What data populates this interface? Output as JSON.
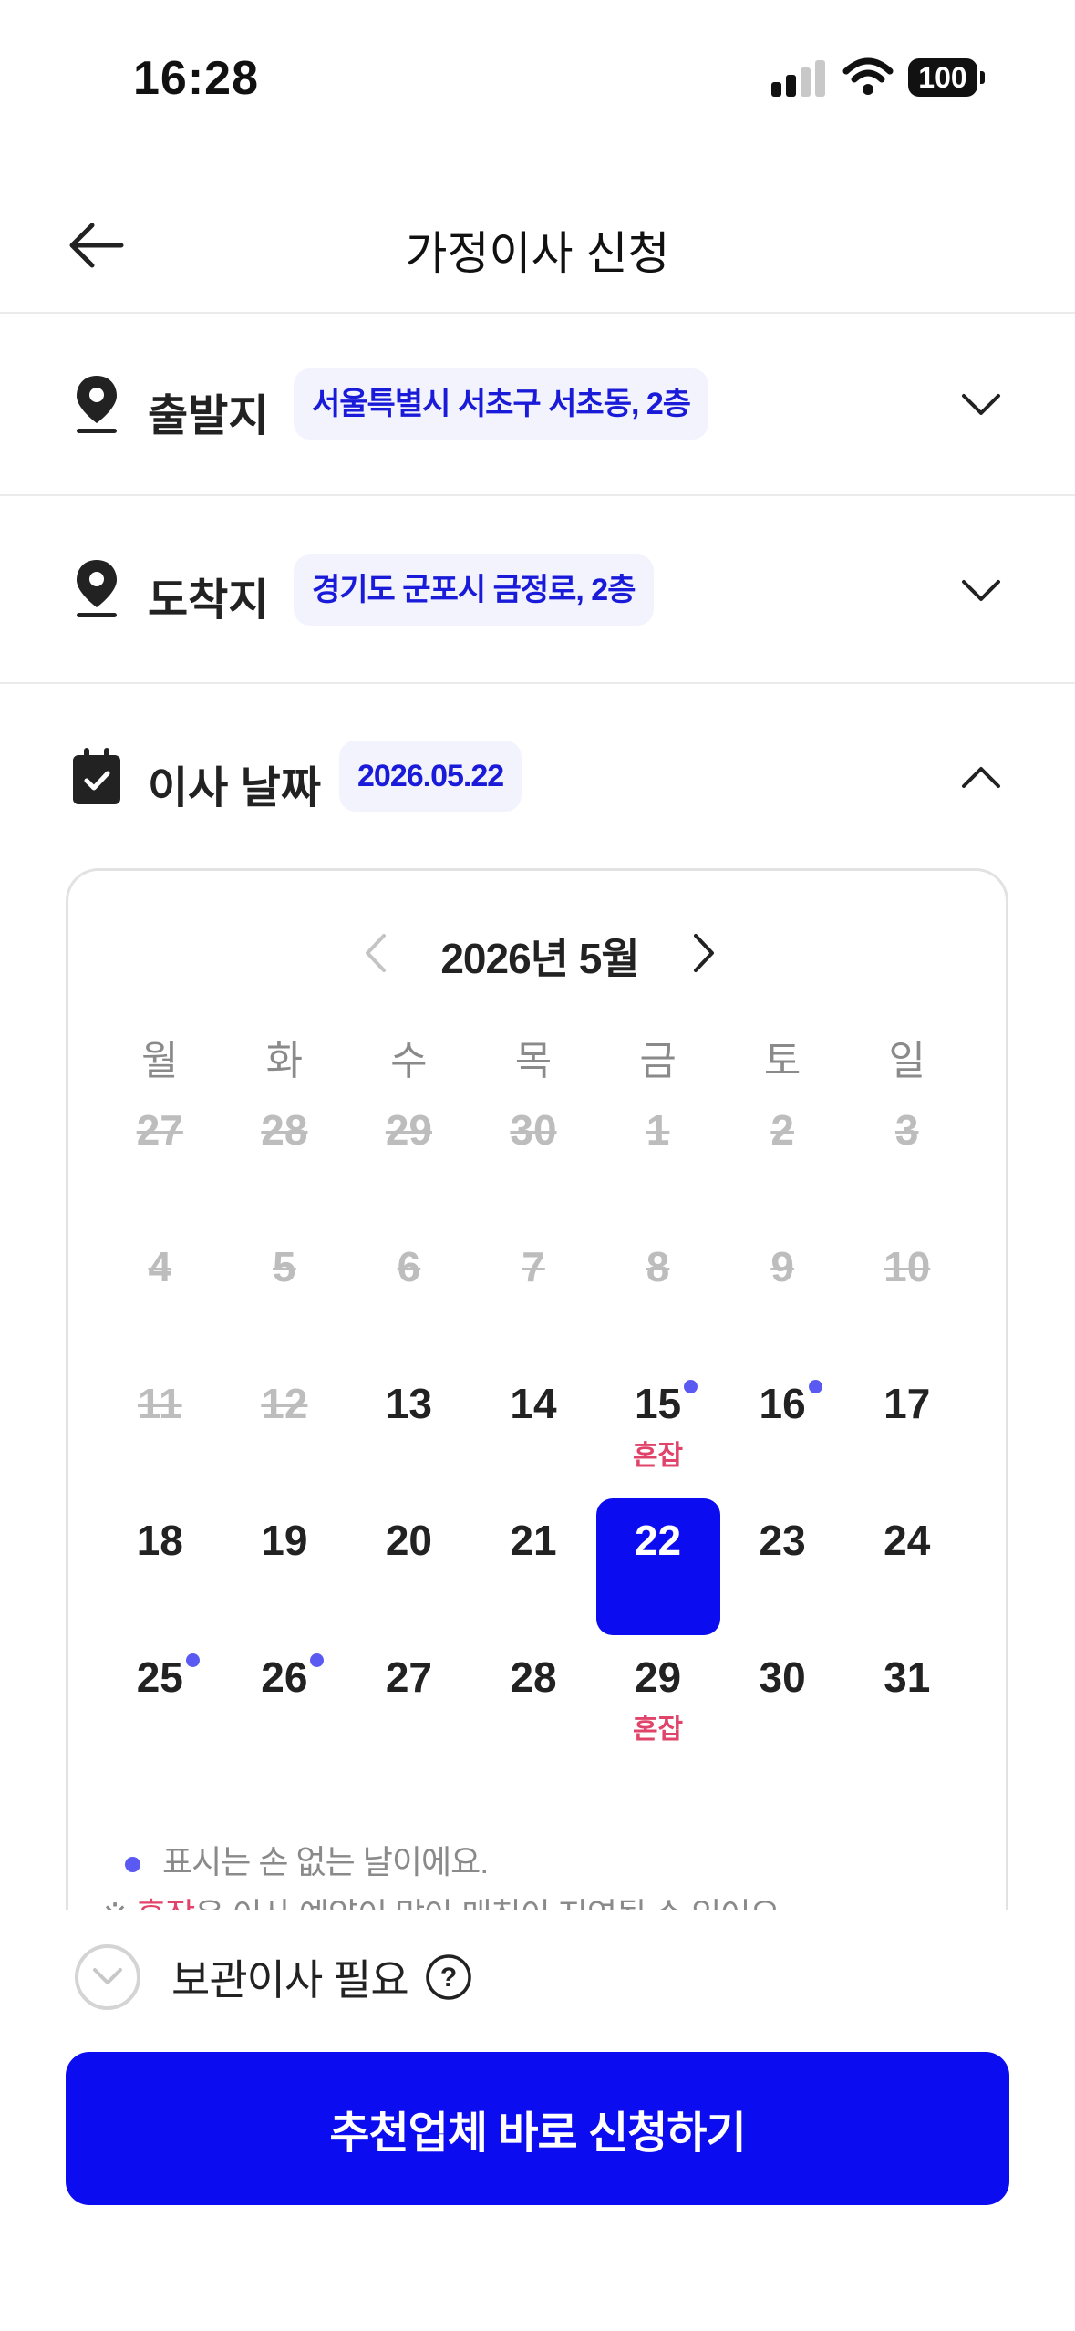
{
  "status_bar": {
    "time": "16:28",
    "battery": "100"
  },
  "header": {
    "title": "가정이사 신청"
  },
  "departure": {
    "label": "출발지",
    "value": "서울특별시 서초구 서초동, 2층"
  },
  "arrival": {
    "label": "도착지",
    "value": "경기도 군포시 금정로, 2층"
  },
  "move_date": {
    "label": "이사 날짜",
    "value": "2026.05.22"
  },
  "calendar": {
    "month_title": "2026년 5월",
    "weekdays": [
      "월",
      "화",
      "수",
      "목",
      "금",
      "토",
      "일"
    ],
    "days": [
      {
        "num": "27",
        "disabled": true
      },
      {
        "num": "28",
        "disabled": true
      },
      {
        "num": "29",
        "disabled": true
      },
      {
        "num": "30",
        "disabled": true
      },
      {
        "num": "1",
        "disabled": true
      },
      {
        "num": "2",
        "disabled": true
      },
      {
        "num": "3",
        "disabled": true
      },
      {
        "num": "4",
        "disabled": true
      },
      {
        "num": "5",
        "disabled": true
      },
      {
        "num": "6",
        "disabled": true
      },
      {
        "num": "7",
        "disabled": true
      },
      {
        "num": "8",
        "disabled": true
      },
      {
        "num": "9",
        "disabled": true
      },
      {
        "num": "10",
        "disabled": true
      },
      {
        "num": "11",
        "disabled": true
      },
      {
        "num": "12",
        "disabled": true
      },
      {
        "num": "13"
      },
      {
        "num": "14"
      },
      {
        "num": "15",
        "dot": true,
        "tag": "혼잡"
      },
      {
        "num": "16",
        "dot": true
      },
      {
        "num": "17"
      },
      {
        "num": "18"
      },
      {
        "num": "19"
      },
      {
        "num": "20"
      },
      {
        "num": "21"
      },
      {
        "num": "22",
        "selected": true
      },
      {
        "num": "23"
      },
      {
        "num": "24"
      },
      {
        "num": "25",
        "dot": true
      },
      {
        "num": "26",
        "dot": true
      },
      {
        "num": "27"
      },
      {
        "num": "28"
      },
      {
        "num": "29",
        "tag": "혼잡"
      },
      {
        "num": "30"
      },
      {
        "num": "31"
      }
    ],
    "legend_dot_text": "표시는 손 없는 날이에요.",
    "legend_busy_prefix": "※ ",
    "legend_busy_word": "혼잡",
    "legend_busy_text": "은 이사 예약이 많아 매칭이 지연될 수 있어요."
  },
  "storage": {
    "label": "보관이사 필요"
  },
  "cta": {
    "label": "추천업체 바로 신청하기"
  },
  "colors": {
    "accent": "#0c0cf0",
    "chip_text": "#1a1ad9",
    "chip_bg": "#f3f3fd",
    "busy": "#e0446b",
    "dot": "#5a5af2"
  }
}
